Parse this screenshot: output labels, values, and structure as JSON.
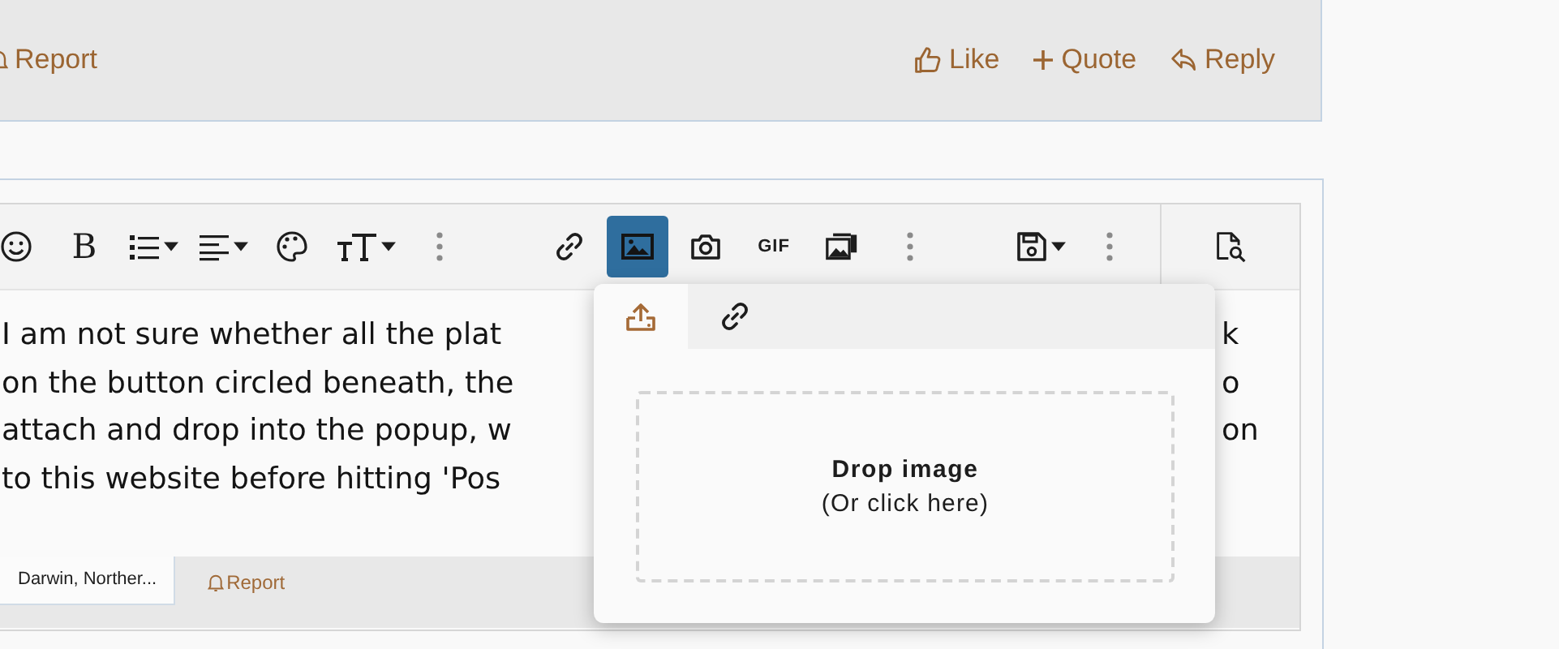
{
  "post_actions": {
    "left": [
      {
        "kind": "report",
        "label": "Report"
      }
    ],
    "right": [
      {
        "kind": "like",
        "label": "Like"
      },
      {
        "kind": "quote",
        "label": "Quote"
      },
      {
        "kind": "reply",
        "label": "Reply"
      }
    ]
  },
  "toolbar": {
    "groups": [
      [
        {
          "kind": "emoji",
          "selected": false,
          "dropdown": false
        },
        {
          "kind": "bold",
          "label": "B",
          "selected": false,
          "dropdown": false
        },
        {
          "kind": "list",
          "selected": false,
          "dropdown": true
        },
        {
          "kind": "align",
          "selected": false,
          "dropdown": true
        },
        {
          "kind": "palette",
          "selected": false,
          "dropdown": false
        },
        {
          "kind": "textsize",
          "selected": false,
          "dropdown": true
        },
        {
          "kind": "more",
          "selected": false,
          "dropdown": false
        }
      ],
      [
        {
          "kind": "link",
          "selected": false,
          "dropdown": false
        },
        {
          "kind": "image",
          "selected": true,
          "dropdown": false
        },
        {
          "kind": "camera",
          "selected": false,
          "dropdown": false
        },
        {
          "kind": "gif",
          "label": "GIF",
          "selected": false,
          "dropdown": false
        },
        {
          "kind": "media",
          "selected": false,
          "dropdown": false
        },
        {
          "kind": "more",
          "selected": false,
          "dropdown": false
        }
      ],
      [
        {
          "kind": "save",
          "selected": false,
          "dropdown": true
        },
        {
          "kind": "more",
          "selected": false,
          "dropdown": false
        }
      ]
    ],
    "preview": {
      "kind": "preview"
    }
  },
  "editor_lines": [
    {
      "left": "I am not sure whether all the plat",
      "right": "k"
    },
    {
      "left": "on the button circled beneath, the",
      "right": "o"
    },
    {
      "left": "attach and drop into the popup, w",
      "right": "on"
    },
    {
      "left": "to this website before hitting 'Pos"
    }
  ],
  "attachment_tag": "Darwin, Norther...",
  "quote_footer": {
    "report": "Report"
  },
  "popup": {
    "tabs": [
      {
        "kind": "upload",
        "selected": true
      },
      {
        "kind": "link",
        "selected": false
      }
    ],
    "drop_title": "Drop image",
    "drop_hint": "(Or click here)"
  }
}
